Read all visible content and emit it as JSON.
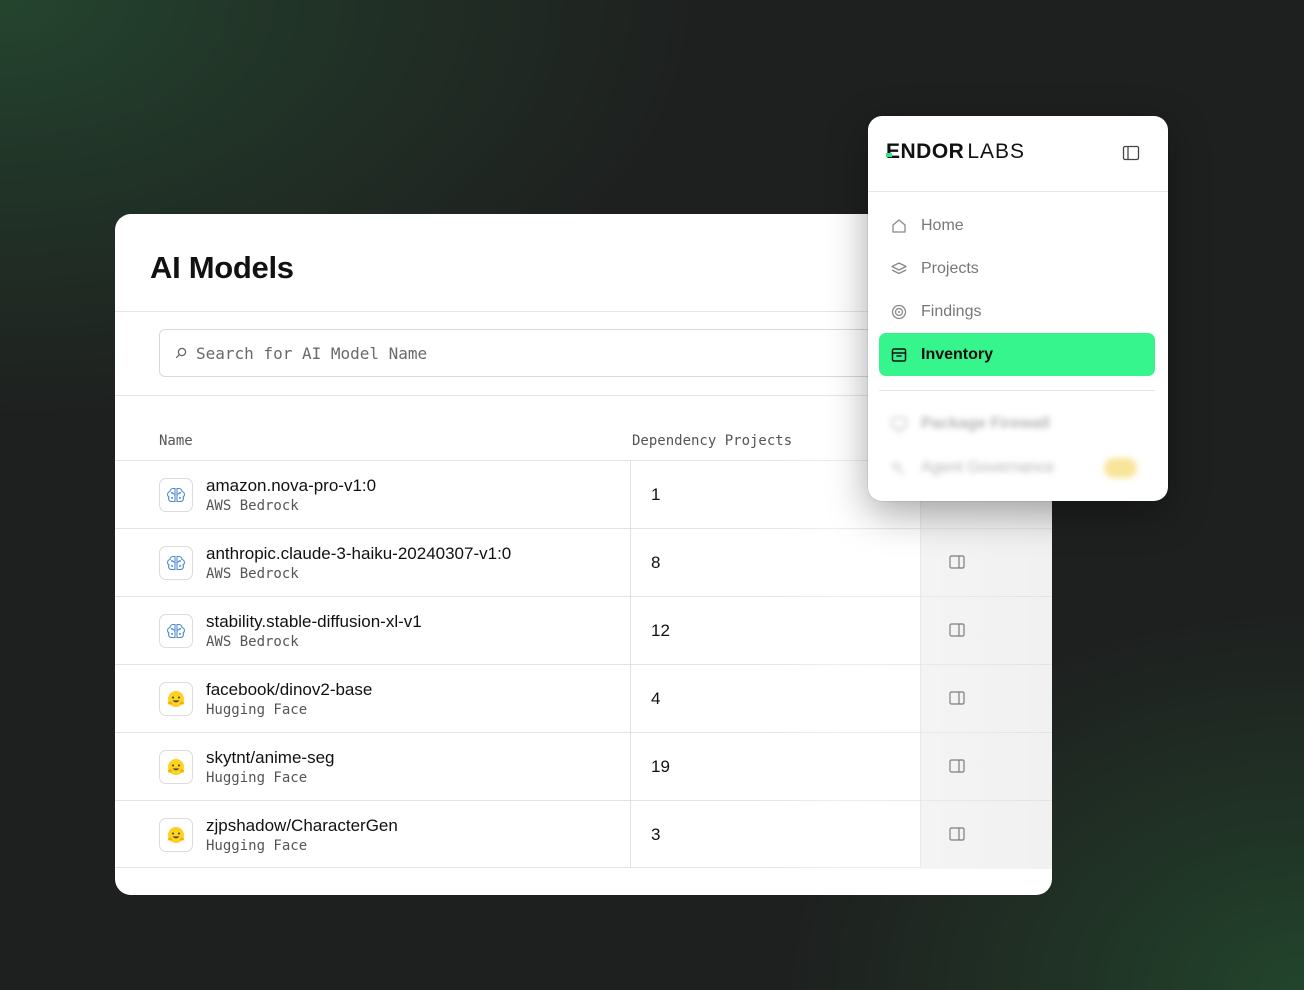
{
  "page": {
    "title": "AI Models",
    "search": {
      "placeholder": "Search for AI Model Name",
      "value": ""
    }
  },
  "table": {
    "columns": [
      "Name",
      "Dependency Projects"
    ],
    "rows": [
      {
        "name": "amazon.nova-pro-v1:0",
        "provider": "AWS Bedrock",
        "icon": "bedrock-brain-icon",
        "dependency_projects": "1"
      },
      {
        "name": "anthropic.claude-3-haiku-20240307-v1:0",
        "provider": "AWS Bedrock",
        "icon": "bedrock-brain-icon",
        "dependency_projects": "8"
      },
      {
        "name": "stability.stable-diffusion-xl-v1",
        "provider": "AWS Bedrock",
        "icon": "bedrock-brain-icon",
        "dependency_projects": "12"
      },
      {
        "name": "facebook/dinov2-base",
        "provider": "Hugging Face",
        "icon": "hugging-face-icon",
        "dependency_projects": "4"
      },
      {
        "name": "skytnt/anime-seg",
        "provider": "Hugging Face",
        "icon": "hugging-face-icon",
        "dependency_projects": "19"
      },
      {
        "name": "zjpshadow/CharacterGen",
        "provider": "Hugging Face",
        "icon": "hugging-face-icon",
        "dependency_projects": "3"
      }
    ]
  },
  "sidebar": {
    "logo_bold": "ENDOR",
    "logo_light": "LABS",
    "items": [
      {
        "label": "Home",
        "icon": "home-icon",
        "active": false
      },
      {
        "label": "Projects",
        "icon": "layers-icon",
        "active": false
      },
      {
        "label": "Findings",
        "icon": "target-icon",
        "active": false
      },
      {
        "label": "Inventory",
        "icon": "archive-box-icon",
        "active": true
      },
      {
        "label": "Package Firewall",
        "icon": "monitor-icon",
        "active": false
      },
      {
        "label": "Agent Governance",
        "icon": "key-icon",
        "active": false
      }
    ]
  },
  "colors": {
    "accent_green": "#35f58c",
    "background": "#1e201f",
    "badge_yellow": "#f5cf4a"
  }
}
